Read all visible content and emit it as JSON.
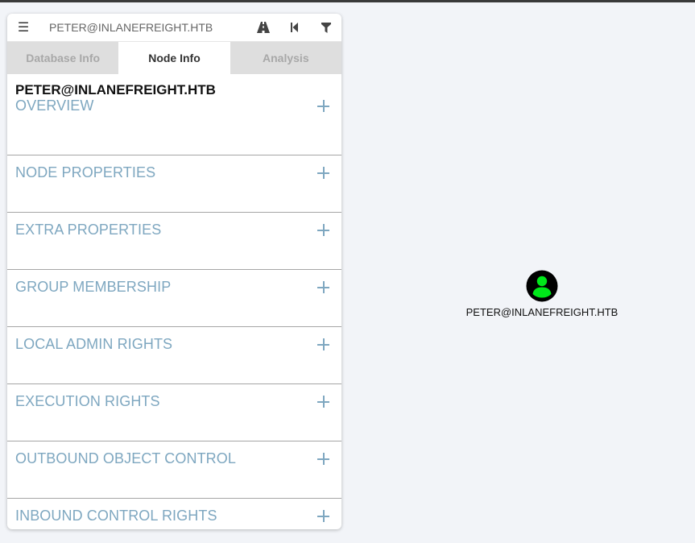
{
  "search": {
    "value": "PETER@INLANEFREIGHT.HTB"
  },
  "toolbar": {
    "menu_icon": "hamburger-menu-icon",
    "pathfinding_icon": "road-icon",
    "back_icon": "step-backward-icon",
    "filter_icon": "filter-icon"
  },
  "tabs": [
    {
      "label": "Database Info",
      "active": false
    },
    {
      "label": "Node Info",
      "active": true
    },
    {
      "label": "Analysis",
      "active": false
    }
  ],
  "node_info": {
    "title": "PETER@INLANEFREIGHT.HTB",
    "sections": [
      {
        "label": "OVERVIEW"
      },
      {
        "label": "NODE PROPERTIES"
      },
      {
        "label": "EXTRA PROPERTIES"
      },
      {
        "label": "GROUP MEMBERSHIP"
      },
      {
        "label": "LOCAL ADMIN RIGHTS"
      },
      {
        "label": "EXECUTION RIGHTS"
      },
      {
        "label": "OUTBOUND OBJECT CONTROL"
      },
      {
        "label": "INBOUND CONTROL RIGHTS"
      }
    ]
  },
  "graph": {
    "node": {
      "label": "PETER@INLANEFREIGHT.HTB",
      "icon": "user-icon",
      "icon_color": "#00e81a",
      "ring_color": "#000000"
    }
  },
  "colors": {
    "section_label": "#7ea7c0",
    "background": "#f2f4f8",
    "tab_inactive_bg": "#dedede"
  }
}
